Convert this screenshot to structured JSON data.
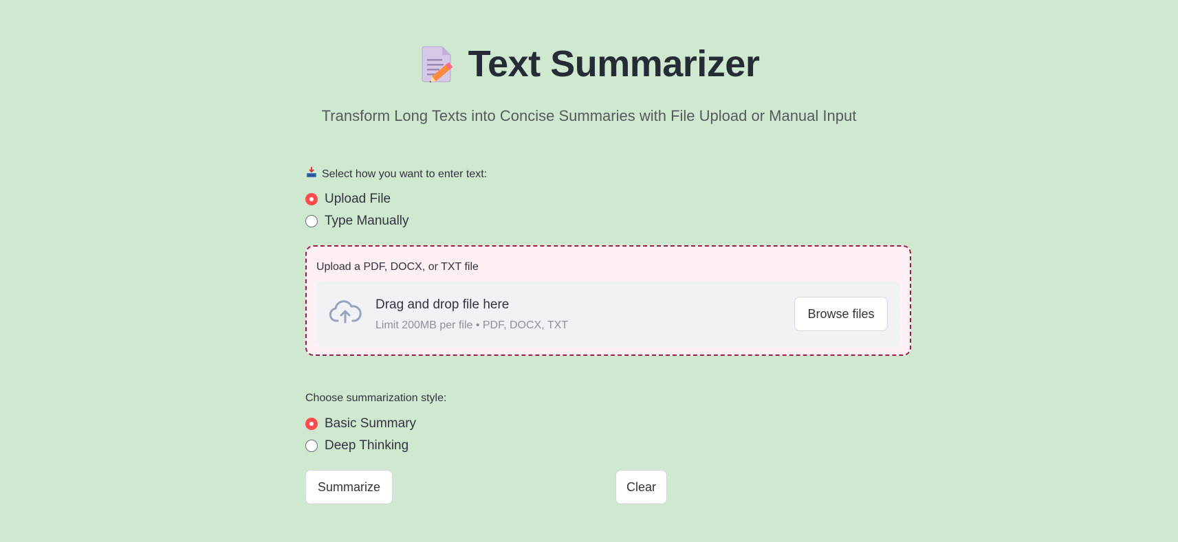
{
  "header": {
    "title": "Text Summarizer",
    "title_icon": "memo-icon",
    "subtitle": "Transform Long Texts into Concise Summaries with File Upload or Manual Input"
  },
  "input_method": {
    "label": "Select how you want to enter text:",
    "label_icon": "inbox-tray-icon",
    "options": [
      {
        "label": "Upload File",
        "selected": true
      },
      {
        "label": "Type Manually",
        "selected": false
      }
    ]
  },
  "uploader": {
    "label": "Upload a PDF, DOCX, or TXT file",
    "drop_title": "Drag and drop file here",
    "drop_hint": "Limit 200MB per file • PDF, DOCX, TXT",
    "browse_label": "Browse files",
    "icon": "cloud-upload-icon"
  },
  "style": {
    "label": "Choose summarization style:",
    "options": [
      {
        "label": "Basic Summary",
        "selected": true
      },
      {
        "label": "Deep Thinking",
        "selected": false
      }
    ]
  },
  "actions": {
    "summarize_label": "Summarize",
    "clear_label": "Clear"
  },
  "colors": {
    "background": "#cfe9d0",
    "accent": "#ff4b4b",
    "upload_border": "#9c1b45",
    "upload_background": "#fff0f3",
    "dropzone_background": "#f0f2f6"
  }
}
